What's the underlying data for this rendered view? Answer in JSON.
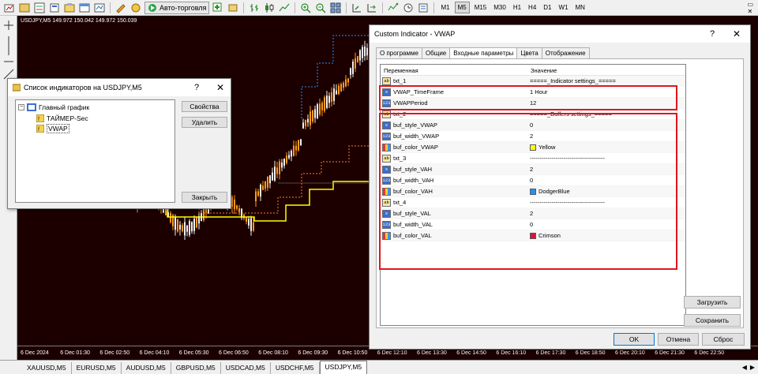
{
  "toolbar": {
    "auto_trading": "Авто-торговля",
    "timeframes": [
      "M1",
      "M5",
      "M15",
      "M30",
      "H1",
      "H4",
      "D1",
      "W1",
      "MN"
    ],
    "active_timeframe": "M5"
  },
  "chart": {
    "header": "USDJPY,M5  149.972 150.042 149.972 150.039",
    "time_ticks": [
      "6 Dec 2024",
      "6 Dec 01:30",
      "6 Dec 02:50",
      "6 Dec 04:10",
      "6 Dec 05:30",
      "6 Dec 06:50",
      "6 Dec 08:10",
      "6 Dec 09:30",
      "6 Dec 10:50",
      "6 Dec 12:10",
      "6 Dec 13:30",
      "6 Dec 14:50",
      "6 Dec 16:10",
      "6 Dec 17:30",
      "6 Dec 18:50",
      "6 Dec 20:10",
      "6 Dec 21:30",
      "6 Dec 22:50"
    ]
  },
  "symbol_tabs": [
    "XAUUSD,M5",
    "EURUSD,M5",
    "AUDUSD,M5",
    "GBPUSD,M5",
    "USDCAD,M5",
    "USDCHF,M5",
    "USDJPY,M5"
  ],
  "active_symbol_tab": "USDJPY,M5",
  "indicator_list": {
    "title": "Список индикаторов на USDJPY,M5",
    "help_glyph": "?",
    "close_glyph": "✕",
    "tree": {
      "root": "Главный график",
      "children": [
        "ТАЙМЕР-Sec",
        "VWAP"
      ]
    },
    "buttons": {
      "properties": "Свойства",
      "delete": "Удалить",
      "close": "Закрыть"
    }
  },
  "vwap_dialog": {
    "title": "Custom Indicator - VWAP",
    "help_glyph": "?",
    "close_glyph": "✕",
    "tabs": [
      "О программе",
      "Общие",
      "Входные параметры",
      "Цвета",
      "Отображение"
    ],
    "active_tab": "Входные параметры",
    "columns": {
      "variable": "Переменная",
      "value": "Значение"
    },
    "rows": [
      {
        "type": "ab",
        "name": "txt_1",
        "value": "=====_Indicator settings_====="
      },
      {
        "type": "enum",
        "name": "VWAP_TimeFrame",
        "value": "1 Hour"
      },
      {
        "type": "num",
        "name": "VWAPPeriod",
        "value": "12"
      },
      {
        "type": "ab",
        "name": "txt_2",
        "value": "=====_Buffers settings_====="
      },
      {
        "type": "enum",
        "name": "buf_style_VWAP",
        "value": "0"
      },
      {
        "type": "num",
        "name": "buf_width_VWAP",
        "value": "2"
      },
      {
        "type": "color",
        "name": "buf_color_VWAP",
        "value": "Yellow",
        "color": "#ffff00"
      },
      {
        "type": "ab",
        "name": "txt_3",
        "value": "--------------------------------------"
      },
      {
        "type": "enum",
        "name": "buf_style_VAH",
        "value": "2"
      },
      {
        "type": "num",
        "name": "buf_width_VAH",
        "value": "0"
      },
      {
        "type": "color",
        "name": "buf_color_VAH",
        "value": "DodgerBlue",
        "color": "#1e90ff"
      },
      {
        "type": "ab",
        "name": "txt_4",
        "value": "--------------------------------------"
      },
      {
        "type": "enum",
        "name": "buf_style_VAL",
        "value": "2"
      },
      {
        "type": "num",
        "name": "buf_width_VAL",
        "value": "0"
      },
      {
        "type": "color",
        "name": "buf_color_VAL",
        "value": "Crimson",
        "color": "#dc143c"
      }
    ],
    "buttons": {
      "load": "Загрузить",
      "save": "Сохранить",
      "ok": "OK",
      "cancel": "Отмена",
      "reset": "Сброс"
    }
  },
  "colors": {
    "chart_bg": "#1c0000",
    "candle_up": "#f2f2f2",
    "candle_down": "#ff9b1a",
    "vwap_line": "#ffff00",
    "vah_line": "#1e90ff",
    "val_line": "#ff7a2e",
    "highlight_box": "#e0161b"
  }
}
